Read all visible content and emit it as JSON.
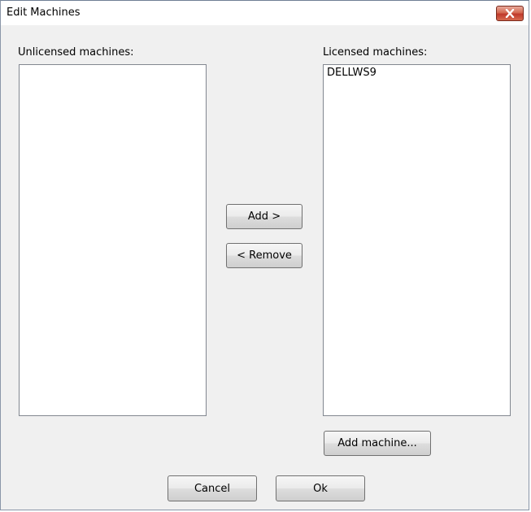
{
  "window": {
    "title": "Edit Machines",
    "close_icon": "close-icon"
  },
  "unlicensed": {
    "label": "Unlicensed machines:",
    "items": []
  },
  "licensed": {
    "label": "Licensed machines:",
    "items": [
      "DELLWS9"
    ]
  },
  "buttons": {
    "add": "Add >",
    "remove": "< Remove",
    "add_machine": "Add machine...",
    "cancel": "Cancel",
    "ok": "Ok"
  },
  "colors": {
    "close_button": "#c0392b",
    "dialog_background": "#f0f0f0"
  }
}
